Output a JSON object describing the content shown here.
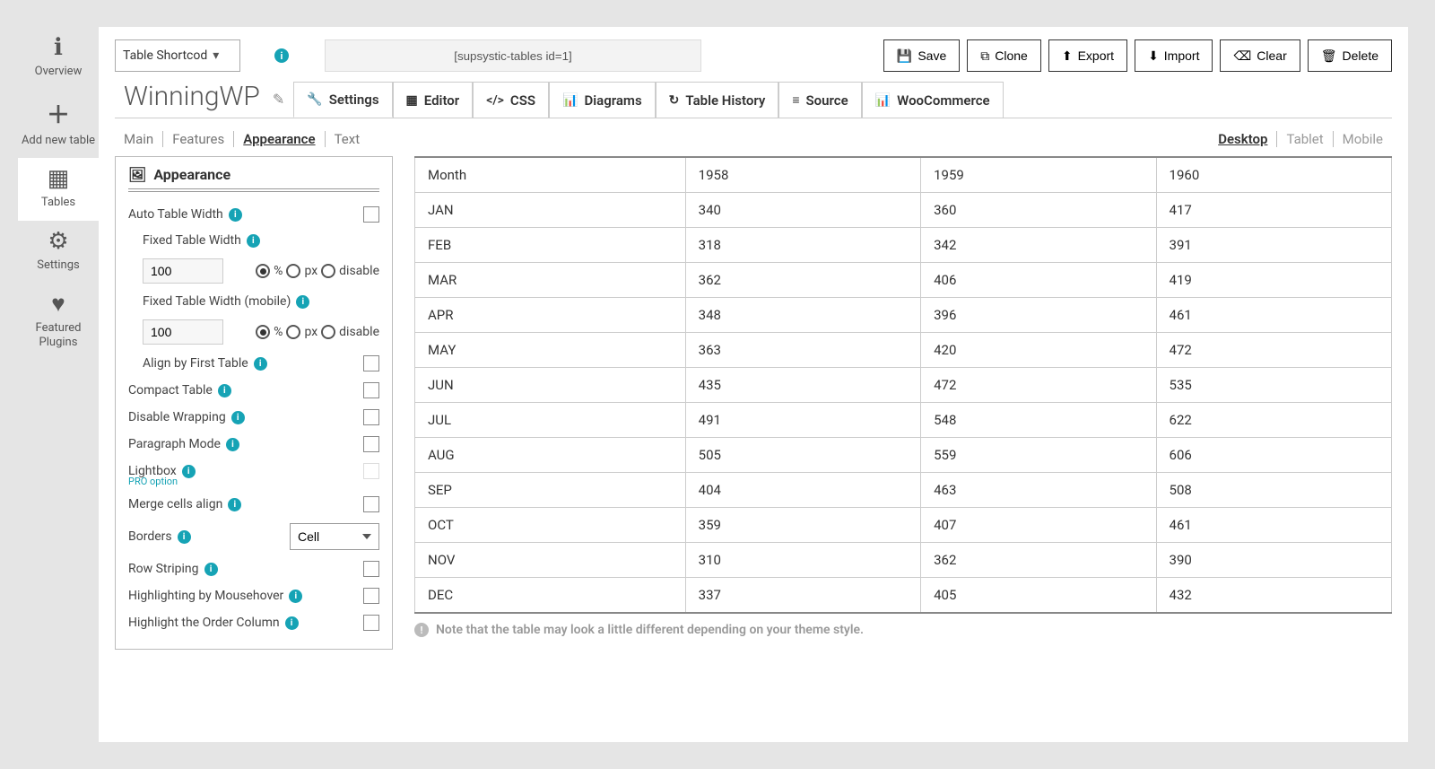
{
  "sidebar": {
    "items": [
      {
        "label": "Overview",
        "icon": "ℹ"
      },
      {
        "label": "Add new table",
        "icon": "＋"
      },
      {
        "label": "Tables",
        "icon": "▦"
      },
      {
        "label": "Settings",
        "icon": "⚙"
      },
      {
        "label": "Featured Plugins",
        "icon": "♥"
      }
    ]
  },
  "topbar": {
    "shortcode_select": "Table Shortcod",
    "shortcode_value": "[supsystic-tables id=1]",
    "buttons": {
      "save": "Save",
      "clone": "Clone",
      "export": "Export",
      "import": "Import",
      "clear": "Clear",
      "delete": "Delete"
    }
  },
  "title": "WinningWP",
  "tabs": [
    {
      "label": "Settings",
      "icon": "wrench"
    },
    {
      "label": "Editor",
      "icon": "grid"
    },
    {
      "label": "CSS",
      "icon": "angle"
    },
    {
      "label": "Diagrams",
      "icon": "bars"
    },
    {
      "label": "Table History",
      "icon": "history"
    },
    {
      "label": "Source",
      "icon": "db"
    },
    {
      "label": "WooCommerce",
      "icon": "bars"
    }
  ],
  "sub_tabs": [
    "Main",
    "Features",
    "Appearance",
    "Text"
  ],
  "sub_tab_active": "Appearance",
  "device_tabs": [
    "Desktop",
    "Tablet",
    "Mobile"
  ],
  "device_tab_active": "Desktop",
  "panel": {
    "title": "Appearance",
    "auto_width": "Auto Table Width",
    "fixed_width": "Fixed Table Width",
    "fixed_width_mobile": "Fixed Table Width (mobile)",
    "width_value": "100",
    "width_value_mobile": "100",
    "unit_percent": "%",
    "unit_px": "px",
    "unit_disable": "disable",
    "align_first": "Align by First Table",
    "compact": "Compact Table",
    "disable_wrap": "Disable Wrapping",
    "paragraph": "Paragraph Mode",
    "lightbox": "Lightbox",
    "pro_option": "PRO option",
    "merge_align": "Merge cells align",
    "borders": "Borders",
    "borders_value": "Cell",
    "row_striping": "Row Striping",
    "highlight_hover": "Highlighting by Mousehover",
    "highlight_order": "Highlight the Order Column"
  },
  "preview_note": "Note that the table may look a little different depending on your theme style.",
  "chart_data": {
    "type": "table",
    "columns": [
      "Month",
      "1958",
      "1959",
      "1960"
    ],
    "rows": [
      [
        "JAN",
        340,
        360,
        417
      ],
      [
        "FEB",
        318,
        342,
        391
      ],
      [
        "MAR",
        362,
        406,
        419
      ],
      [
        "APR",
        348,
        396,
        461
      ],
      [
        "MAY",
        363,
        420,
        472
      ],
      [
        "JUN",
        435,
        472,
        535
      ],
      [
        "JUL",
        491,
        548,
        622
      ],
      [
        "AUG",
        505,
        559,
        606
      ],
      [
        "SEP",
        404,
        463,
        508
      ],
      [
        "OCT",
        359,
        407,
        461
      ],
      [
        "NOV",
        310,
        362,
        390
      ],
      [
        "DEC",
        337,
        405,
        432
      ]
    ]
  }
}
